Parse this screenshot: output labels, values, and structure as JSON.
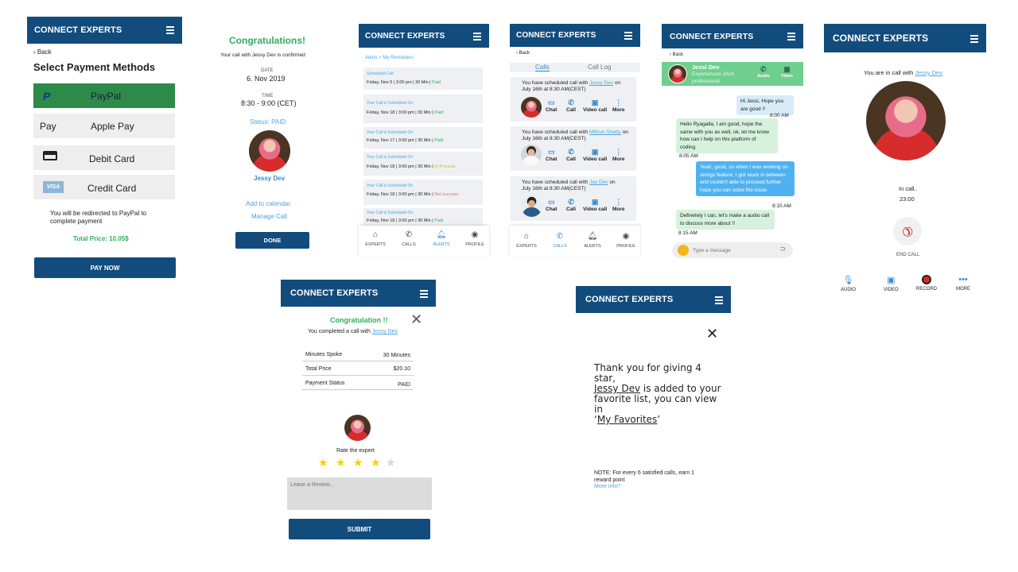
{
  "brand": "CONNECT EXPERTS",
  "payment": {
    "back": "Back",
    "title": "Select Payment Methods",
    "methods": [
      {
        "label": "PayPal",
        "icon": "paypal-icon"
      },
      {
        "label": "Apple Pay",
        "icon": "apple-pay-icon"
      },
      {
        "label": "Debit Card",
        "icon": "card-icon"
      },
      {
        "label": "Credit Card",
        "icon": "visa-icon"
      }
    ],
    "redirect": "You will be redirected to PayPal to complete payment",
    "total": "Total Price: 10.05$",
    "pay_now": "PAY NOW"
  },
  "confirm": {
    "title": "Congratulations!",
    "subtitle": "Your call with Jessy Dev is confirmed",
    "date_label": "DATE",
    "date": "6. Nov 2019",
    "time_label": "TIME",
    "time": "8:30 - 9:00 (CET)",
    "status": "Status: PAID",
    "name": "Jessy Dev",
    "add_calendar": "Add to calendar",
    "manage": "Manage Call",
    "done": "DONE"
  },
  "alerts": {
    "crumb_1": "Alerts",
    "crumb_sep": ">",
    "crumb_2": "My Reminders",
    "cards": [
      {
        "head": "Scheduled Call",
        "detail": "Friday, Nov 5  |  3:00 pm  |  30 Min | ",
        "status": "Paid",
        "status_color": "#2fae5f"
      },
      {
        "head": "Your Call is Scheduled On",
        "detail": "Friday, Nov 18  |  3:00 pm  |  30 Min | ",
        "status": "Paid",
        "status_color": "#2fae5f"
      },
      {
        "head": "Your Call is Scheduled On",
        "detail": "Friday, Nov 17  |  3:00 pm  |  30 Min | ",
        "status": "Paid",
        "status_color": "#2fae5f"
      },
      {
        "head": "Your Call is Scheduled On",
        "detail": "Friday, Nov 18  |  3:00 pm  |  30 Min | ",
        "status": "In-Process",
        "status_color": "#c9c21a"
      },
      {
        "head": "Your Call is Scheduled On",
        "detail": "Friday, Nov 18  |  3:00 pm  |  30 Min | ",
        "status": "Not success",
        "status_color": "#ef6a6a"
      },
      {
        "head": "Your Call is Scheduled On",
        "detail": "Friday, Nov 18  |  3:00 pm  |  30 Min | ",
        "status": "Paid",
        "status_color": "#2fae5f"
      }
    ],
    "nav": [
      "EXPERTS",
      "CALLS",
      "ALERTS",
      "PROFILE"
    ]
  },
  "calls": {
    "back": "Back",
    "tab_calls": "Calls",
    "tab_log": "Call Log",
    "cards": [
      {
        "pre": "You have scheduled call with ",
        "name": "Jessy Dev",
        "post": " on",
        "line2": "July 16th at 8:30 AM(CEST)"
      },
      {
        "pre": "You have scheduled call with ",
        "name": "Mithun Shetty",
        "post": " on",
        "line2": "July 16th at 8:30 AM(CEST)"
      },
      {
        "pre": "You have scheduled call with ",
        "name": "Jay Dev",
        "post": " on",
        "line2": "July 16th at 8:30 AM(CEST)"
      }
    ],
    "actions": [
      "Chat",
      "Call",
      "Video call",
      "More"
    ],
    "nav": [
      "EXPERTS",
      "CALLS",
      "ALERTS",
      "PROFILE"
    ]
  },
  "chat": {
    "back": "Back",
    "name": "Jessi Dev",
    "role_1": "Experienced JAVA",
    "role_2": "professional",
    "audio": "Audio",
    "video": "Video",
    "messages": [
      {
        "text": "Hi Jessi, Hope you are good !!",
        "time": "8:00 AM",
        "side": "right"
      },
      {
        "text": "Hello Ryagalla, I am good, hope the same with you as well, ok, let me know how can I help on this platform of coding.",
        "time": "8:05 AM",
        "side": "left"
      },
      {
        "text": "Yeah, good, so when I was working on strings feature, I got stuck in between and couldn't able to proceed further hope you can solve the issue.",
        "time": "8:10 AM",
        "side": "right"
      },
      {
        "text": "Definetely I can, let's make a audio call to discuss more about !!",
        "time": "8:15 AM",
        "side": "left"
      }
    ],
    "placeholder": "Type a message"
  },
  "incall": {
    "pre": "You are in call with ",
    "name": "Jessy Dev",
    "status": "In call..",
    "timer": "23:00",
    "end": "END CALL",
    "controls": [
      "AUDIO",
      "VIDEO",
      "RECORD",
      "MORE"
    ]
  },
  "summary": {
    "title": "Congratulation !!",
    "pre": "You completed a call with ",
    "name": "Jessy Dev",
    "rows": [
      {
        "k": "Minutes Spoke",
        "v": "30 Minutes"
      },
      {
        "k": "Total Price",
        "v": "$20.10"
      },
      {
        "k": "Payment Status",
        "v": "PAID"
      }
    ],
    "rate": "Rate the expert",
    "rating": 4,
    "max_rating": 5,
    "review_placeholder": "Leave a Review...",
    "submit": "SUBMIT"
  },
  "thanks": {
    "line1": "Thank you for giving 4 star,",
    "name": "Jessy Dev",
    "line2": " is added to your",
    "line3": "favorite list, you can view in",
    "fav_pre": "‘",
    "fav": "My Favorites",
    "fav_post": "’",
    "note": "NOTE: For every 6 satisfied calls, earn 1 reward point",
    "more": "More info?"
  }
}
